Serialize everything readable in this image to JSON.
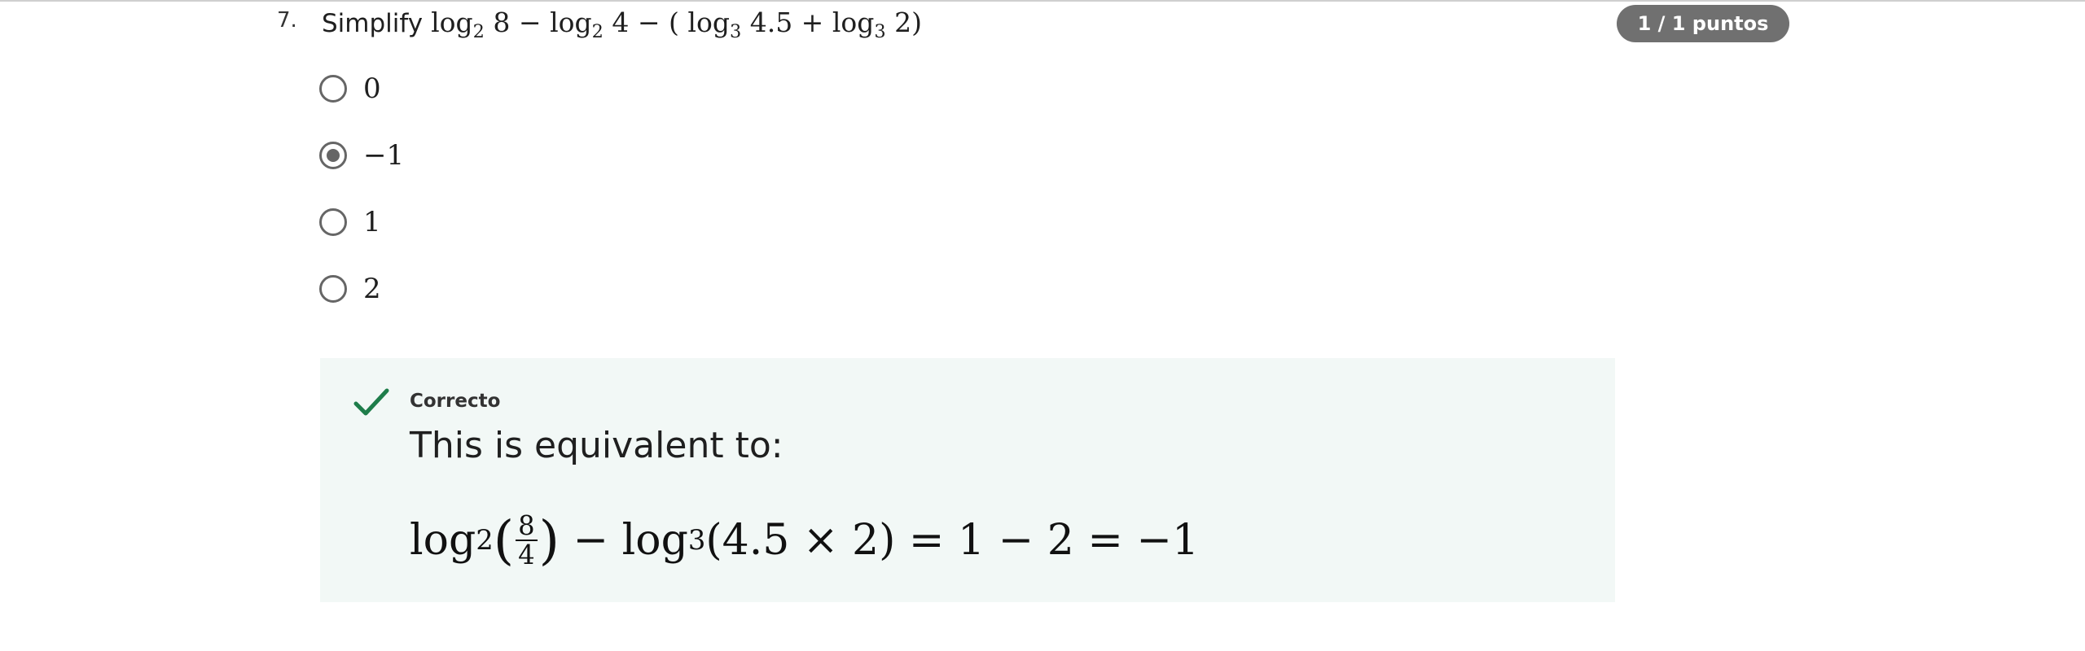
{
  "question": {
    "number": "7.",
    "prefix": "Simplify",
    "expression": {
      "a": "log",
      "a_base": "2",
      "a_arg": " 8 − ",
      "b": "log",
      "b_base": "2",
      "b_arg": " 4 − (",
      "c": "log",
      "c_base": "3",
      "c_arg": " 4.5 + ",
      "d": "log",
      "d_base": "3",
      "d_arg": " 2)"
    },
    "points": "1 / 1 puntos"
  },
  "options": [
    {
      "label": "0",
      "selected": false
    },
    {
      "label": "−1",
      "selected": true
    },
    {
      "label": "1",
      "selected": false
    },
    {
      "label": "2",
      "selected": false
    }
  ],
  "feedback": {
    "status": "Correcto",
    "text": "This is equivalent to:",
    "math": {
      "log1": "log",
      "base1": "2",
      "open1": "(",
      "num": "8",
      "den": "4",
      "close1": ")",
      "minus": " − ",
      "log2": "log",
      "base2": "3",
      "rest": "(4.5 × 2) = 1 − 2 = −1"
    },
    "accent_color": "#1e7d4a",
    "background_color": "#f2f8f6"
  },
  "icons": {
    "check": "check-icon"
  }
}
